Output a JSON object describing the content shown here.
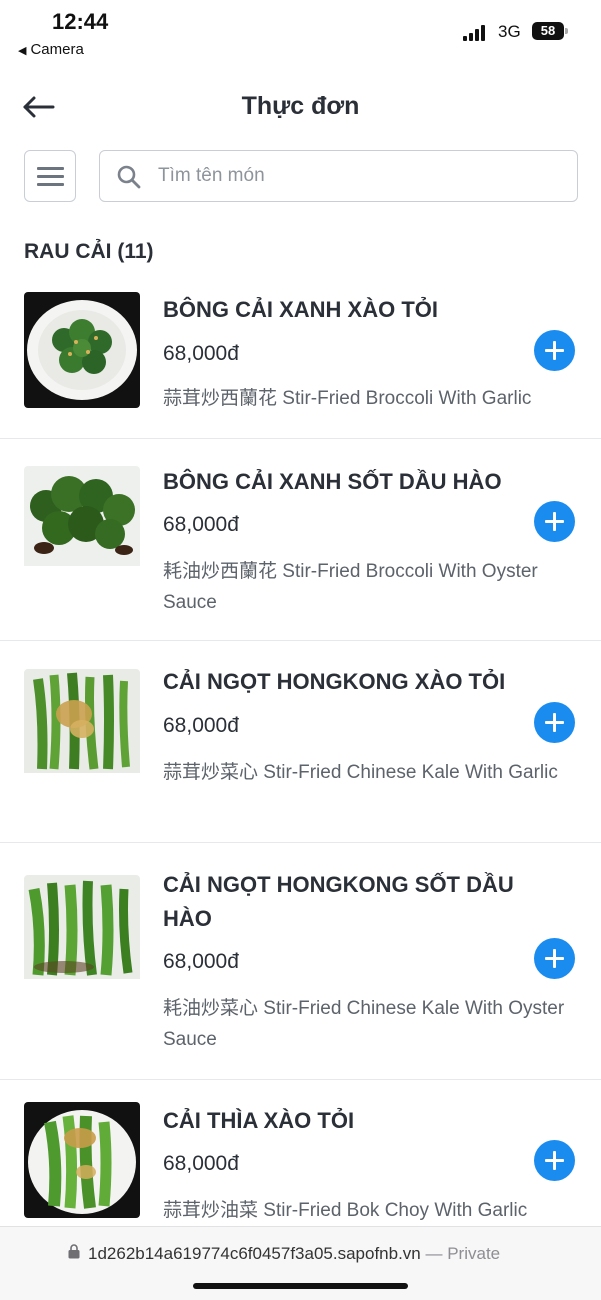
{
  "status_bar": {
    "time": "12:44",
    "back_label": "Camera",
    "back_icon": "◀",
    "network": "3G",
    "battery": "58"
  },
  "header": {
    "title": "Thực đơn"
  },
  "search": {
    "placeholder": "Tìm tên món"
  },
  "category": {
    "title": "RAU CẢI (11)"
  },
  "items": [
    {
      "name": "BÔNG CẢI XANH XÀO TỎI",
      "price": "68,000đ",
      "description": "蒜茸炒西蘭花 Stir-Fried Broccoli With Garlic"
    },
    {
      "name": "BÔNG CẢI XANH SỐT DẦU HÀO",
      "price": "68,000đ",
      "description": "耗油炒西蘭花 Stir-Fried Broccoli With Oyster Sauce"
    },
    {
      "name": "CẢI NGỌT HONGKONG XÀO TỎI",
      "price": "68,000đ",
      "description": "蒜茸炒菜心 Stir-Fried Chinese Kale With Garlic"
    },
    {
      "name": "CẢI NGỌT HONGKONG SỐT DẦU HÀO",
      "price": "68,000đ",
      "description": "耗油炒菜心 Stir-Fried Chinese Kale With Oyster Sauce"
    },
    {
      "name": "CẢI THÌA XÀO TỎI",
      "price": "68,000đ",
      "description": "蒜茸炒油菜 Stir-Fried Bok Choy With Garlic"
    }
  ],
  "browser": {
    "url": "1d262b14a619774c6f0457f3a05.sapofnb.vn",
    "mode": " — Private"
  },
  "colors": {
    "accent": "#1a8cf0",
    "text": "#2b3038",
    "muted": "#5d636b"
  },
  "icons": {
    "back": "arrow-left-icon",
    "menu": "hamburger-icon",
    "search": "search-icon",
    "add": "plus-circle-icon",
    "lock": "lock-icon"
  }
}
